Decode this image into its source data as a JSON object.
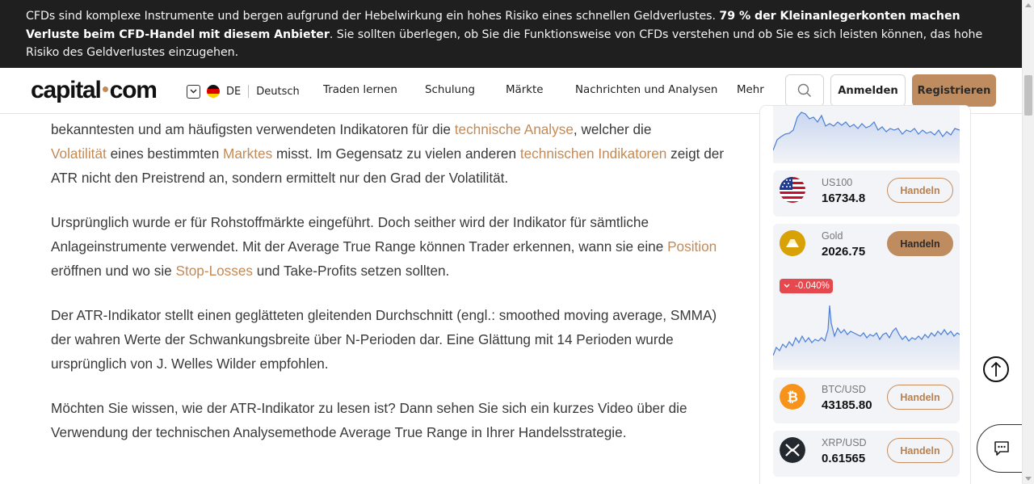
{
  "risk_banner": {
    "text_before": "CFDs sind komplexe Instrumente und bergen aufgrund der Hebelwirkung ein hohes Risiko eines schnellen Geldverlustes. ",
    "bold_text": "79 % der Kleinanlegerkonten machen Verluste beim CFD-Handel mit diesem Anbieter",
    "text_after": ". Sie sollten überlegen, ob Sie die Funktionsweise von CFDs verstehen und ob Sie es sich leisten können, das hohe Risiko des Geldverlustes einzugehen."
  },
  "header": {
    "logo_left": "capital",
    "logo_right": "com",
    "lang_code": "DE",
    "lang_name": "Deutsch",
    "nav": [
      "Traden lernen",
      "Schulung",
      "Märkte",
      "Nachrichten und Analysen",
      "Mehr"
    ],
    "login_label": "Anmelden",
    "register_label": "Registrieren",
    "search_icon": "search-icon"
  },
  "article": {
    "p1": {
      "t1": "bekanntesten und am häufigsten verwendeten Indikatoren für die ",
      "l1": "technische Analyse",
      "t2": ", welcher die ",
      "l2": "Volatilität",
      "t3": " eines bestimmten ",
      "l3": "Marktes",
      "t4": " misst. Im Gegensatz zu vielen anderen ",
      "l4": "technischen Indikatoren",
      "t5": " zeigt der ATR nicht den Preistrend an, sondern ermittelt nur den Grad der Volatilität."
    },
    "p2": {
      "t1": "Ursprünglich wurde er für Rohstoffmärkte eingeführt. Doch seither wird der Indikator für sämtliche Anlageinstrumente verwendet. Mit der Average True Range können Trader erkennen, wann sie eine ",
      "l1": "Position",
      "t2": " eröffnen und wo sie ",
      "l2": "Stop-Losses",
      "t3": " und Take-Profits setzen sollten."
    },
    "p3": "Der ATR-Indikator stellt einen geglätteten gleitenden Durchschnitt (engl.: smoothed moving average, SMMA) der wahren Werte der Schwankungsbreite über N-Perioden dar. Eine Glättung mit 14 Perioden wurde ursprünglich von J. Welles Wilder empfohlen.",
    "p4": "Möchten Sie wissen, wie der ATR-Indikator zu lesen ist? Dann sehen Sie sich ein kurzes Video über die Verwendung der technischen Analysemethode Average True Range in Ihrer Handelsstrategie."
  },
  "markets": {
    "trade_label": "Handeln",
    "items": [
      {
        "name": "US100",
        "price": "16734.8",
        "icon": "us-flag-icon"
      },
      {
        "name": "Gold",
        "price": "2026.75",
        "icon": "gold-icon",
        "change": "-0.040%",
        "change_color": "#e5484d"
      },
      {
        "name": "BTC/USD",
        "price": "43185.80",
        "icon": "bitcoin-icon"
      },
      {
        "name": "XRP/USD",
        "price": "0.61565",
        "icon": "xrp-icon"
      }
    ]
  },
  "colors": {
    "accent": "#bf8c60",
    "link": "#c48a55",
    "banner_bg": "#1f1f1f",
    "negative": "#e5484d",
    "sparkline": "#4a7fd4"
  }
}
